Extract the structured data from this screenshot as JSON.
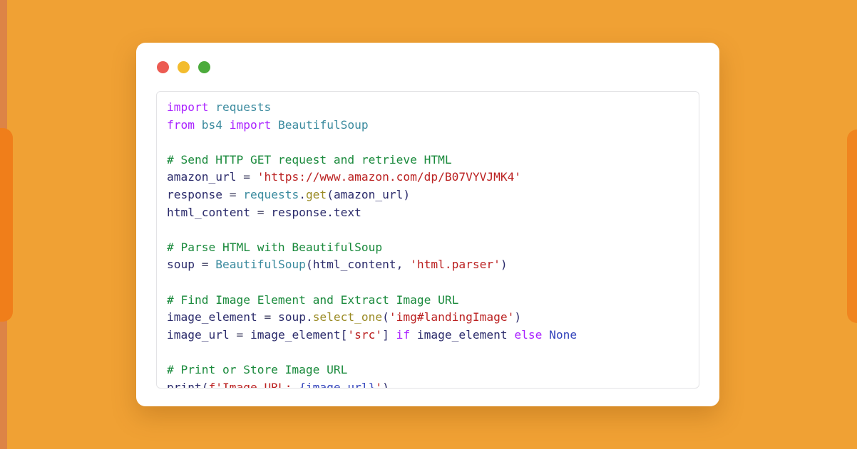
{
  "theme": {
    "page_background": "#f0a134",
    "page_left_strip": "#dd8446",
    "decor_shape_left": "#f07e1a",
    "decor_shape_right": "#f0851f",
    "card_background": "#ffffff",
    "code_block_border": "#e3e3e6",
    "keyword_color": "#aa22ff",
    "name_color": "#3a8a9e",
    "comment_color": "#1a8a3c",
    "string_color": "#bb2222",
    "variable_color": "#2b2b6b",
    "function_color": "#9b8b25",
    "constant_color": "#3344bb"
  },
  "window": {
    "controls": [
      {
        "name": "close",
        "label": "close-dot",
        "color": "#ec5b52"
      },
      {
        "name": "minimize",
        "label": "minimize-dot",
        "color": "#f3bc2e"
      },
      {
        "name": "maximize",
        "label": "maximize-dot",
        "color": "#4cab3c"
      }
    ]
  },
  "code": {
    "language": "python",
    "plain_text": "import requests\nfrom bs4 import BeautifulSoup\n\n# Send HTTP GET request and retrieve HTML\namazon_url = 'https://www.amazon.com/dp/B07VYVJMK4'\nresponse = requests.get(amazon_url)\nhtml_content = response.text\n\n# Parse HTML with BeautifulSoup\nsoup = BeautifulSoup(html_content, 'html.parser')\n\n# Find Image Element and Extract Image URL\nimage_element = soup.select_one('img#landingImage')\nimage_url = image_element['src'] if image_element else None\n\n# Print or Store Image URL\nprint(f'Image URL: {image_url}')",
    "lines": [
      {
        "n": 1,
        "tokens": [
          {
            "t": "import",
            "c": "kw"
          },
          {
            "t": " ",
            "c": "op"
          },
          {
            "t": "requests",
            "c": "name"
          }
        ]
      },
      {
        "n": 2,
        "tokens": [
          {
            "t": "from",
            "c": "kw"
          },
          {
            "t": " ",
            "c": "op"
          },
          {
            "t": "bs4",
            "c": "name"
          },
          {
            "t": " ",
            "c": "op"
          },
          {
            "t": "import",
            "c": "kw"
          },
          {
            "t": " ",
            "c": "op"
          },
          {
            "t": "BeautifulSoup",
            "c": "name"
          }
        ]
      },
      {
        "n": 3,
        "tokens": []
      },
      {
        "n": 4,
        "tokens": [
          {
            "t": "# Send HTTP GET request and retrieve HTML",
            "c": "comment"
          }
        ]
      },
      {
        "n": 5,
        "tokens": [
          {
            "t": "amazon_url",
            "c": "var"
          },
          {
            "t": " = ",
            "c": "op"
          },
          {
            "t": "'https://www.amazon.com/dp/B07VYVJMK4'",
            "c": "str"
          }
        ]
      },
      {
        "n": 6,
        "tokens": [
          {
            "t": "response",
            "c": "var"
          },
          {
            "t": " = ",
            "c": "op"
          },
          {
            "t": "requests",
            "c": "name"
          },
          {
            "t": ".",
            "c": "punc"
          },
          {
            "t": "get",
            "c": "fn"
          },
          {
            "t": "(",
            "c": "punc"
          },
          {
            "t": "amazon_url",
            "c": "var"
          },
          {
            "t": ")",
            "c": "punc"
          }
        ]
      },
      {
        "n": 7,
        "tokens": [
          {
            "t": "html_content",
            "c": "var"
          },
          {
            "t": " = ",
            "c": "op"
          },
          {
            "t": "response",
            "c": "var"
          },
          {
            "t": ".",
            "c": "punc"
          },
          {
            "t": "text",
            "c": "var"
          }
        ]
      },
      {
        "n": 8,
        "tokens": []
      },
      {
        "n": 9,
        "tokens": [
          {
            "t": "# Parse HTML with BeautifulSoup",
            "c": "comment"
          }
        ]
      },
      {
        "n": 10,
        "tokens": [
          {
            "t": "soup",
            "c": "var"
          },
          {
            "t": " = ",
            "c": "op"
          },
          {
            "t": "BeautifulSoup",
            "c": "name"
          },
          {
            "t": "(",
            "c": "punc"
          },
          {
            "t": "html_content",
            "c": "var"
          },
          {
            "t": ", ",
            "c": "punc"
          },
          {
            "t": "'html.parser'",
            "c": "str"
          },
          {
            "t": ")",
            "c": "punc"
          }
        ]
      },
      {
        "n": 11,
        "tokens": []
      },
      {
        "n": 12,
        "tokens": [
          {
            "t": "# Find Image Element and Extract Image URL",
            "c": "comment"
          }
        ]
      },
      {
        "n": 13,
        "tokens": [
          {
            "t": "image_element",
            "c": "var"
          },
          {
            "t": " = ",
            "c": "op"
          },
          {
            "t": "soup",
            "c": "var"
          },
          {
            "t": ".",
            "c": "punc"
          },
          {
            "t": "select_one",
            "c": "fn"
          },
          {
            "t": "(",
            "c": "punc"
          },
          {
            "t": "'img#landingImage'",
            "c": "str"
          },
          {
            "t": ")",
            "c": "punc"
          }
        ]
      },
      {
        "n": 14,
        "tokens": [
          {
            "t": "image_url",
            "c": "var"
          },
          {
            "t": " = ",
            "c": "op"
          },
          {
            "t": "image_element",
            "c": "var"
          },
          {
            "t": "[",
            "c": "punc"
          },
          {
            "t": "'src'",
            "c": "str"
          },
          {
            "t": "] ",
            "c": "punc"
          },
          {
            "t": "if",
            "c": "kw"
          },
          {
            "t": " ",
            "c": "op"
          },
          {
            "t": "image_element",
            "c": "var"
          },
          {
            "t": " ",
            "c": "op"
          },
          {
            "t": "else",
            "c": "kw"
          },
          {
            "t": " ",
            "c": "op"
          },
          {
            "t": "None",
            "c": "const"
          }
        ]
      },
      {
        "n": 15,
        "tokens": []
      },
      {
        "n": 16,
        "tokens": [
          {
            "t": "# Print or Store Image URL",
            "c": "comment"
          }
        ]
      },
      {
        "n": 17,
        "tokens": [
          {
            "t": "print",
            "c": "var"
          },
          {
            "t": "(",
            "c": "punc"
          },
          {
            "t": "f",
            "c": "str"
          },
          {
            "t": "'Image URL: ",
            "c": "str"
          },
          {
            "t": "{image_url}",
            "c": "const"
          },
          {
            "t": "'",
            "c": "str"
          },
          {
            "t": ")",
            "c": "punc"
          }
        ]
      }
    ]
  }
}
